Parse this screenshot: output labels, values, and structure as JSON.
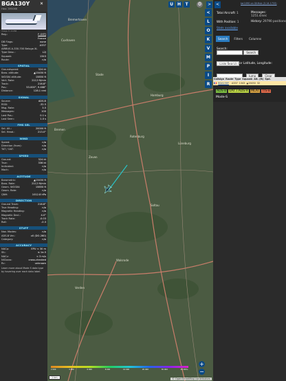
{
  "aircraft": {
    "callsign": "BGA130Y",
    "hex": "Hex: 395066",
    "photo_credit": "image © dir266",
    "close_icon": "close"
  },
  "info": [
    {
      "k": "Reg.:",
      "v": "F-GSTJ",
      "link": true
    },
    {
      "k": "",
      "v": "France"
    },
    {
      "k": "DB Flags:",
      "v": "none"
    },
    {
      "k": "Type:",
      "v": "A337"
    },
    {
      "k": "AIRBUS A-330-700 Beluga XL",
      "v": ""
    },
    {
      "k": "Type Desc.:",
      "v": "L2J"
    },
    {
      "k": "Squawk:",
      "v": "1343"
    },
    {
      "k": "Route:",
      "v": "n/a"
    }
  ],
  "sections": [
    {
      "title": "SPATIAL",
      "rows": [
        [
          "Groundspeed:",
          "324 kt"
        ],
        [
          "Baro. altitude:",
          "▲15450 ft"
        ],
        [
          "WGS84 altitude:",
          "15850 ft"
        ],
        [
          "Vert. Rate:",
          "2112 ft/min"
        ],
        [
          "Track:",
          "216.8°"
        ],
        [
          "Pos.:",
          "53.000°, 9.468°"
        ],
        [
          "Distance:",
          "128.1 nmi"
        ]
      ]
    },
    {
      "title": "SIGNAL",
      "rows": [
        [
          "Source:",
          "ADS-B"
        ],
        [
          "RSSI:",
          "-32.5"
        ],
        [
          "Msg. Rate:",
          "3.5"
        ],
        [
          "Messages:",
          "100"
        ],
        [
          "Last Pos.:",
          "0.1 s"
        ],
        [
          "Last Seen:",
          "1.0 s"
        ]
      ]
    },
    {
      "title": "FMS SEL",
      "rows": [
        [
          "Sel. Alt.:",
          "20000 ft"
        ],
        [
          "Sel. Head.:",
          "213.0°"
        ]
      ]
    },
    {
      "title": "WIND",
      "rows": [
        [
          "Speed:",
          "n/a"
        ],
        [
          "Direction (from):",
          "n/a"
        ],
        [
          "TAT / OAT:",
          "n/a"
        ]
      ]
    },
    {
      "title": "SPEED",
      "rows": [
        [
          "Ground:",
          "324 kt"
        ],
        [
          "True:",
          "336 kt"
        ],
        [
          "Indicated:",
          "n/a"
        ],
        [
          "Mach:",
          "n/a"
        ]
      ]
    },
    {
      "title": "ALTITUDE",
      "rows": [
        [
          "Barometric:",
          "▲15450 ft"
        ],
        [
          "Baro. Rate:",
          "2112 ft/min"
        ],
        [
          "Geom. WGS84:",
          "15850 ft"
        ],
        [
          "Geom. Rate:",
          "n/a"
        ],
        [
          "QNH:",
          "1012.8 hPa"
        ]
      ]
    },
    {
      "title": "DIRECTION",
      "rows": [
        [
          "Ground Track:",
          "216.8°"
        ],
        [
          "True Heading:",
          "n/a"
        ],
        [
          "Magnetic Heading:",
          "n/a"
        ],
        [
          "Magnetic Decl.:",
          "4.0°"
        ],
        [
          "Track Rate:",
          "-0.03"
        ],
        [
          "Roll:",
          "-0.3"
        ]
      ]
    },
    {
      "title": "STUFF",
      "rows": [
        [
          "Nav. Modes:",
          "n/a"
        ],
        [
          "ADS-B Ver.:",
          "v0 (DO-260)"
        ],
        [
          "Category:",
          "n/a"
        ]
      ]
    },
    {
      "title": "ACCURACY",
      "rows": [
        [
          "NACp:",
          "EPU < 30 m"
        ],
        [
          "SIL:",
          "≤ 1e-5"
        ],
        [
          "NACv:",
          "< 3 m/s"
        ],
        [
          "NICbaro:",
          "cross-checked"
        ],
        [
          "Rc:",
          "unknown"
        ]
      ]
    }
  ],
  "footer_note": "Learn more about Mode S data type by hovering over each data label.",
  "map": {
    "buttons_top": [
      "U",
      "H",
      "T"
    ],
    "side_buttons": [
      "<",
      "L",
      "O",
      "K",
      "V",
      "M",
      "P",
      "I",
      "R"
    ],
    "zoom_in": "+",
    "zoom_out": "−",
    "scale_label": "1 km",
    "attribution": "© OpenStreetMap contributors",
    "alt_ticks": [
      "2 000",
      "4 000",
      "6 000",
      "8 000",
      "10 000",
      "20 000",
      "30 000",
      "40 000+"
    ],
    "settings_icon": "gear-icon",
    "next_icon": ">"
  },
  "stats": {
    "version": "tar1090 on GitHub (3.14.1733)",
    "total_label": "Total Aircraft:",
    "total": "1",
    "withpos_label": "With Position:",
    "withpos": "1",
    "messages_label": "Messages:",
    "messages": "1251.4/sec",
    "history_label": "History:",
    "history": "29790 positions",
    "stats_label": "Stats available"
  },
  "tabs": [
    "Search",
    "Filters",
    "Columns"
  ],
  "search": {
    "label": "Search:",
    "button": "Search",
    "clear": "Clear Search",
    "jump_label": "Jump to Airport or Latitude, Longitude:",
    "jump_button": "Jump",
    "clear2": "Clear"
  },
  "table": {
    "headers": [
      "Callsign",
      "Route",
      "Type",
      "Squawk",
      "Alt. (ft)",
      "Spd."
    ],
    "row": {
      "flag": "🇫🇷",
      "callsign": "BGA130Y",
      "route": "",
      "type": "A337",
      "squawk": "1343",
      "alt": "▲15450",
      "spd": "32"
    }
  },
  "badges": [
    {
      "t": "ADS-B",
      "c": "#7ec243"
    },
    {
      "t": "UAT / ADS-R",
      "c": "#b9d244"
    },
    {
      "t": "MLAT",
      "c": "#d7a243"
    },
    {
      "t": "TIS-B",
      "c": "#e06a4a"
    }
  ],
  "modes": "Mode-S",
  "places": [
    "Cuxhaven",
    "Stade",
    "Hamburg",
    "Bremen",
    "Bremerhaven",
    "Rotenburg",
    "Zeven",
    "Lüneburg",
    "Soltau",
    "Walsrode",
    "Verden"
  ],
  "colors": {
    "map_bg": "#4a5a41",
    "panel": "#2b2b2b",
    "accent": "#0a4a86",
    "row": "#ffe7a6"
  }
}
